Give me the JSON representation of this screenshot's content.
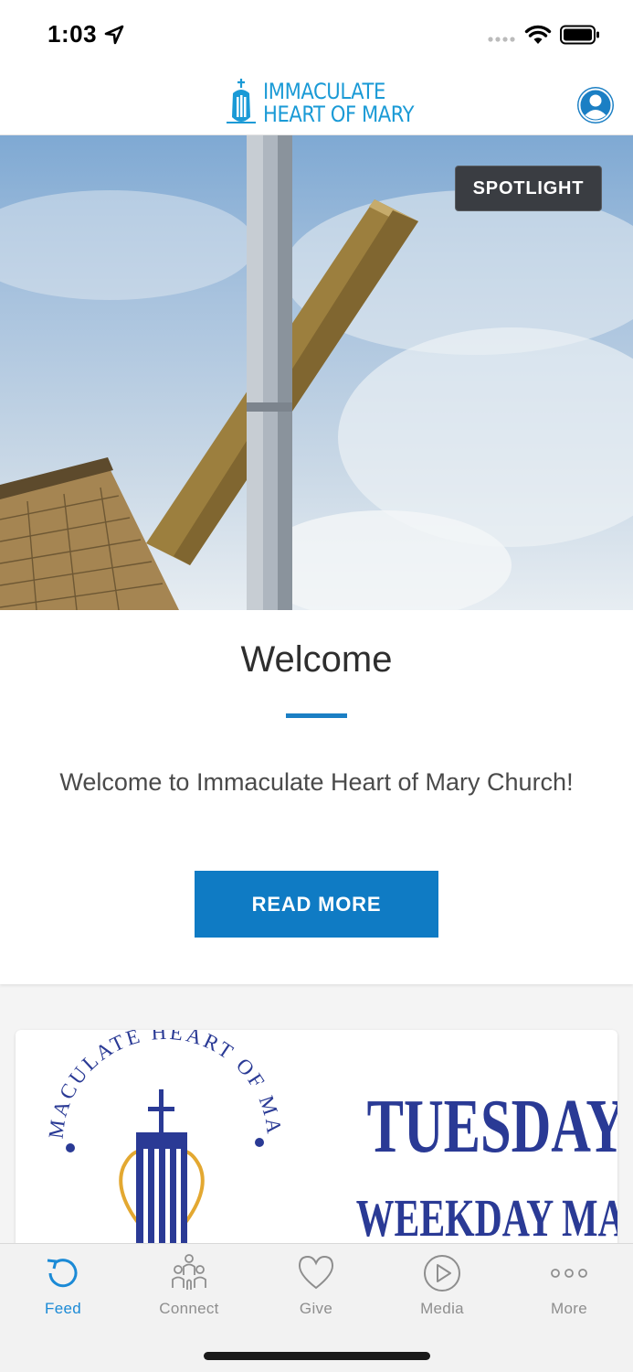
{
  "status_bar": {
    "time": "1:03",
    "icons": [
      "location-arrow-icon",
      "signal-dots-icon",
      "wifi-icon",
      "battery-icon"
    ]
  },
  "header": {
    "logo_line1": "IMMACULATE",
    "logo_line2": "HEART OF MARY",
    "profile_icon": "person-icon",
    "brand_color": "#1a9ad6"
  },
  "hero": {
    "badge": "SPOTLIGHT"
  },
  "welcome": {
    "title": "Welcome",
    "text": "Welcome to Immaculate Heart of Mary Church!",
    "button_label": "READ MORE",
    "accent_color": "#0f7bc4"
  },
  "feed_card": {
    "seal_text": "IMMACULATE HEART OF MARY",
    "title": "TUESDAY",
    "subtitle": "WEEKDAY MASS",
    "text_color": "#2a3a95"
  },
  "tab_bar": {
    "active": "Feed",
    "tabs": [
      {
        "label": "Feed",
        "icon": "refresh-icon"
      },
      {
        "label": "Connect",
        "icon": "people-icon"
      },
      {
        "label": "Give",
        "icon": "heart-icon"
      },
      {
        "label": "Media",
        "icon": "play-icon"
      },
      {
        "label": "More",
        "icon": "more-dots-icon"
      }
    ]
  }
}
